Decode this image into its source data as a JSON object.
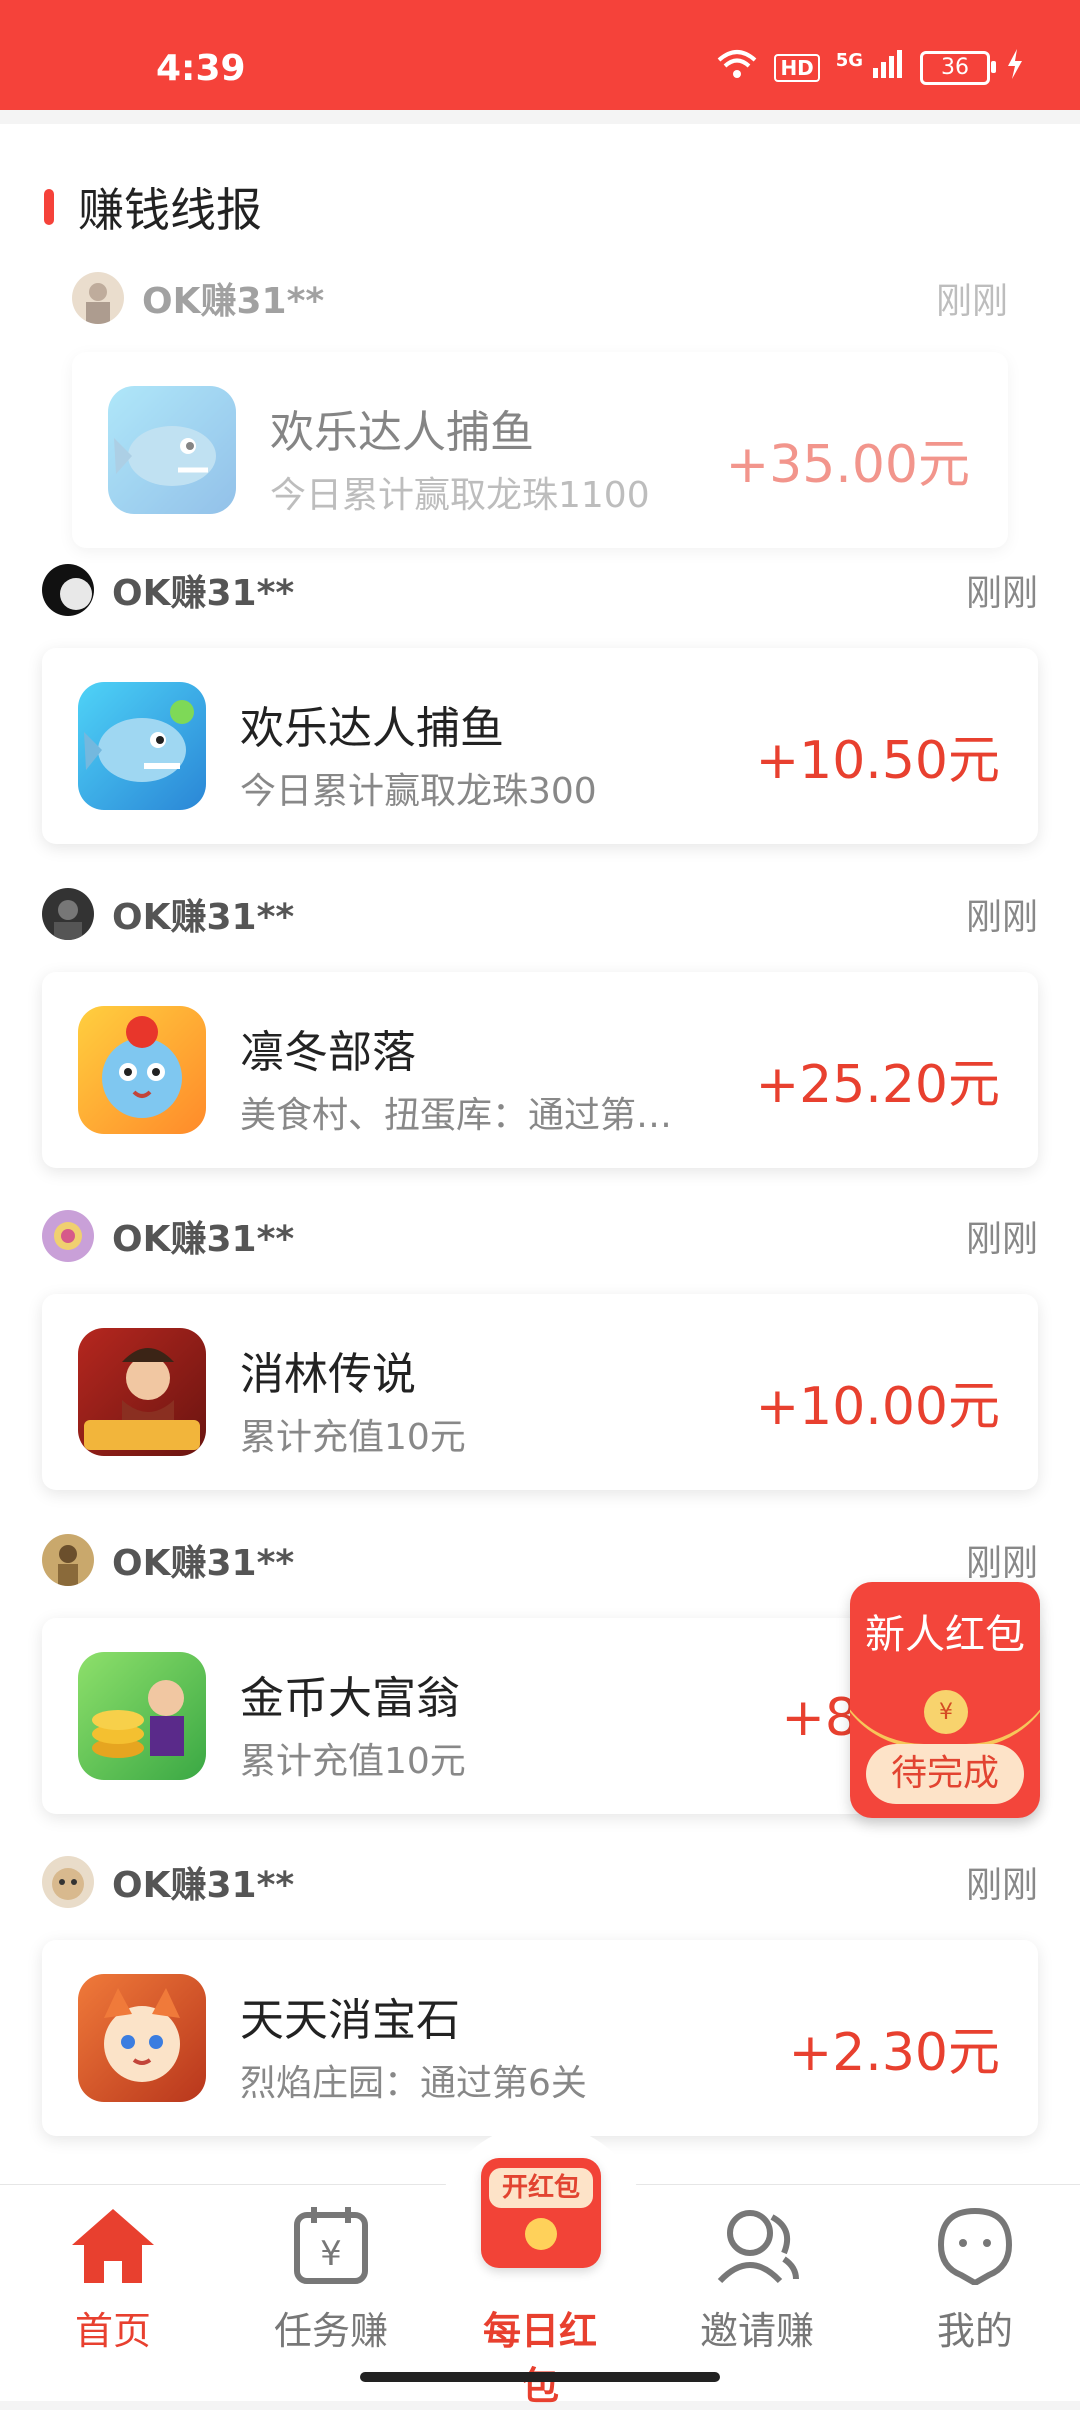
{
  "status": {
    "time": "4:39",
    "network_label": "HD",
    "signal_label": "5G",
    "battery": "36"
  },
  "section": {
    "title": "赚钱线报"
  },
  "feed": [
    {
      "user": "OK赚31**",
      "time": "刚刚",
      "app": "欢乐达人捕鱼",
      "desc": "今日累计赢取龙珠1100",
      "reward": "+35.00元"
    },
    {
      "user": "OK赚31**",
      "time": "刚刚",
      "app": "欢乐达人捕鱼",
      "desc": "今日累计赢取龙珠300",
      "reward": "+10.50元"
    },
    {
      "user": "OK赚31**",
      "time": "刚刚",
      "app": "凛冬部落",
      "desc": "美食村、扭蛋库：通过第…",
      "reward": "+25.20元"
    },
    {
      "user": "OK赚31**",
      "time": "刚刚",
      "app": "消林传说",
      "desc": "累计充值10元",
      "reward": "+10.00元"
    },
    {
      "user": "OK赚31**",
      "time": "刚刚",
      "app": "金币大富翁",
      "desc": "累计充值10元",
      "reward": "+8"
    },
    {
      "user": "OK赚31**",
      "time": "刚刚",
      "app": "天天消宝石",
      "desc": "烈焰庄园：通过第6关",
      "reward": "+2.30元"
    }
  ],
  "floating_badge": {
    "title": "新人红包",
    "button": "待完成"
  },
  "tabbar": {
    "home": "首页",
    "tasks": "任务赚",
    "daily_redpacket": "每日红包",
    "daily_tag": "开红包",
    "invite": "邀请赚",
    "mine": "我的"
  },
  "colors": {
    "brand": "#f5423a",
    "reward": "#e8402f"
  }
}
